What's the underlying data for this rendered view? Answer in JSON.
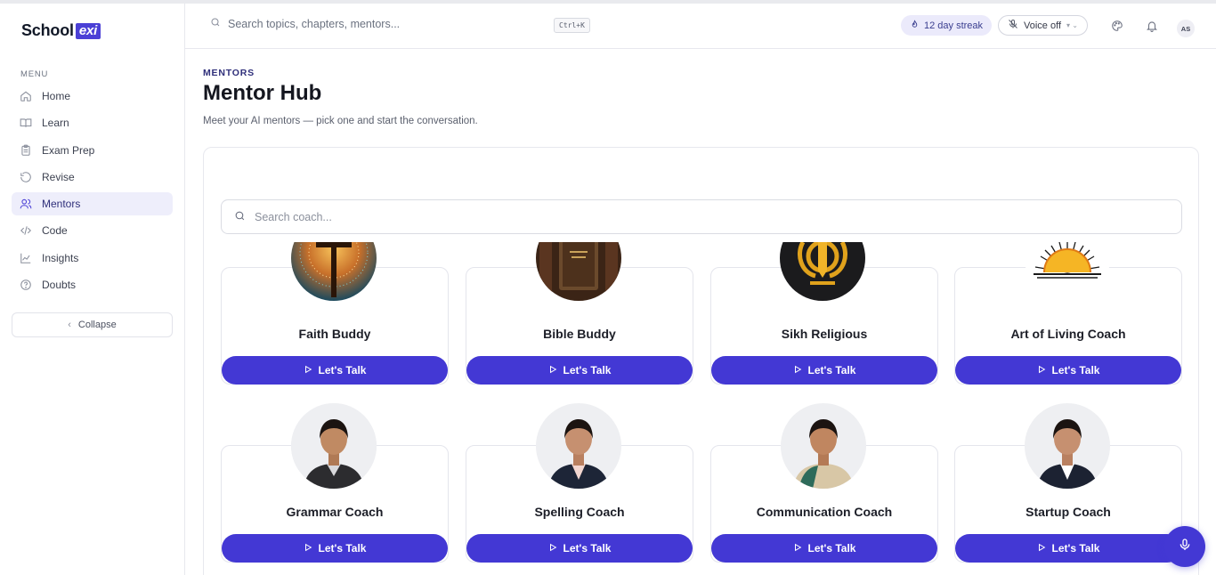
{
  "brand": {
    "name_main": "School",
    "name_mark": "exi"
  },
  "sidebar": {
    "menu_label": "MENU",
    "items": [
      {
        "label": "Home",
        "icon": "home-icon",
        "active": false
      },
      {
        "label": "Learn",
        "icon": "book-icon",
        "active": false
      },
      {
        "label": "Exam Prep",
        "icon": "clipboard-icon",
        "active": false
      },
      {
        "label": "Revise",
        "icon": "refresh-icon",
        "active": false
      },
      {
        "label": "Mentors",
        "icon": "users-icon",
        "active": true
      },
      {
        "label": "Code",
        "icon": "code-icon",
        "active": false
      },
      {
        "label": "Insights",
        "icon": "chart-icon",
        "active": false
      },
      {
        "label": "Doubts",
        "icon": "help-icon",
        "active": false
      }
    ],
    "collapse_label": "Collapse"
  },
  "topbar": {
    "search_placeholder": "Search topics, chapters, mentors...",
    "shortcut": "Ctrl+K",
    "streak": "12 day streak",
    "voice": "Voice off",
    "avatar_initials": "AS"
  },
  "page": {
    "eyebrow": "MENTORS",
    "title": "Mentor Hub",
    "subtitle": "Meet your AI mentors — pick one and start the conversation.",
    "coach_search_placeholder": "Search coach..."
  },
  "mentors": [
    {
      "name": "Faith Buddy",
      "button": "Let's Talk",
      "image": "glowing-cross-portrait"
    },
    {
      "name": "Bible Buddy",
      "button": "Let's Talk",
      "image": "bible-book-portrait"
    },
    {
      "name": "Sikh Religious",
      "button": "Let's Talk",
      "image": "khanda-symbol-portrait"
    },
    {
      "name": "Art of Living Coach",
      "button": "Let's Talk",
      "image": "rising-sun-portrait"
    },
    {
      "name": "Grammar Coach",
      "button": "Let's Talk",
      "image": "woman-portrait"
    },
    {
      "name": "Spelling Coach",
      "button": "Let's Talk",
      "image": "woman-portrait"
    },
    {
      "name": "Communication Coach",
      "button": "Let's Talk",
      "image": "woman-saree-portrait"
    },
    {
      "name": "Startup Coach",
      "button": "Let's Talk",
      "image": "woman-portrait"
    }
  ],
  "colors": {
    "accent": "#4338d4",
    "active_bg": "#eeeefb",
    "streak_bg": "#ebeafb"
  }
}
